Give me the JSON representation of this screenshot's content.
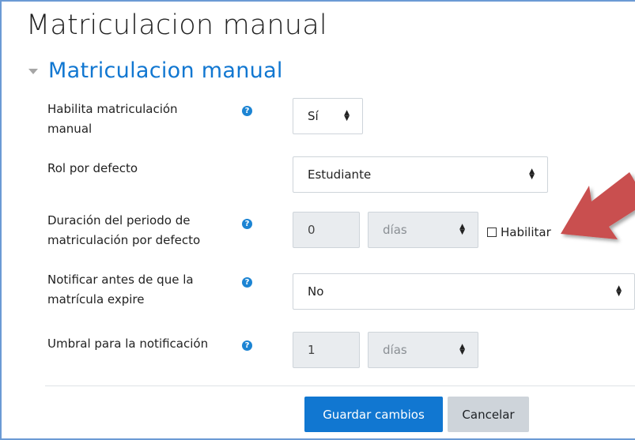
{
  "page": {
    "title": "Matriculacion manual",
    "section_title": "Matriculacion manual"
  },
  "form": {
    "enable": {
      "label_line1": "Habilita matriculación",
      "label_line2": "manual",
      "value": "Sí"
    },
    "role": {
      "label": "Rol por defecto",
      "value": "Estudiante"
    },
    "duration": {
      "label_line1": "Duración del periodo de",
      "label_line2": "matriculación por defecto",
      "number": "0",
      "unit": "días",
      "enable_label": "Habilitar"
    },
    "notify": {
      "label_line1": "Notificar antes de que la",
      "label_line2": "matrícula expire",
      "value": "No"
    },
    "threshold": {
      "label": "Umbral para la notificación",
      "number": "1",
      "unit": "días"
    }
  },
  "buttons": {
    "save": "Guardar cambios",
    "cancel": "Cancelar"
  },
  "icons": {
    "help": "?",
    "caret": "▲▼"
  },
  "colors": {
    "accent": "#1177d1",
    "annotation_arrow": "#c9504f"
  }
}
